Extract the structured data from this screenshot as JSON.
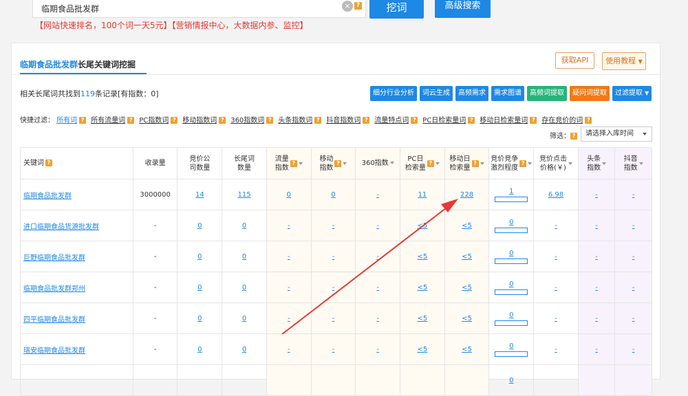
{
  "search": {
    "query": "临期食品批发群",
    "dig_button": "挖词",
    "advanced_button": "高级搜索"
  },
  "promo_text": "【网站快速排名，100个词一天5元】【营销情报中心，大数据内参、监控】",
  "panel": {
    "title_keyword": "临期食品批发群",
    "title_suffix": "长尾关键词挖掘",
    "api_button": "获取API",
    "tutorial_button": "使用教程"
  },
  "summary": {
    "prefix": "相关长尾词共找到",
    "count": "119",
    "suffix": "条记录[有指数：0]"
  },
  "tool_buttons": [
    {
      "label": "细分行业分析",
      "color": "blue"
    },
    {
      "label": "词云生成",
      "color": "blue"
    },
    {
      "label": "高频需求",
      "color": "blue"
    },
    {
      "label": "需求图谱",
      "color": "blue"
    },
    {
      "label": "高频词提取",
      "color": "green"
    },
    {
      "label": "疑问词提取",
      "color": "orange"
    },
    {
      "label": "过滤提取",
      "color": "blue"
    }
  ],
  "filters": {
    "label": "快捷过滤：",
    "items": [
      "所有词",
      "所有流量词",
      "PC指数词",
      "移动指数词",
      "360指数词",
      "头条指数词",
      "抖音指数词",
      "流量特点词",
      "PC日检索量词",
      "移动日检索量词",
      "存在竞价的词"
    ]
  },
  "screen": {
    "label": "筛选：",
    "select_value": "请选择入库时间"
  },
  "table": {
    "headers": [
      "关键词",
      "收录量",
      "竞价公司数量",
      "长尾词数量",
      "流量指数",
      "移动指数",
      "360指数",
      "PC日检索量",
      "移动日检索量",
      "竞价竞争激烈程度",
      "竞价点击价格(￥)",
      "头条指数",
      "抖音指数"
    ],
    "headers_display": [
      [
        "关键词"
      ],
      [
        "收录量"
      ],
      [
        "竞价公",
        "司数量"
      ],
      [
        "长尾词",
        "数量"
      ],
      [
        "流量",
        "指数"
      ],
      [
        "移动",
        "指数"
      ],
      [
        "360指数"
      ],
      [
        "PC日",
        "检索量"
      ],
      [
        "移动日",
        "检索量"
      ],
      [
        "竞价竞争",
        "激烈程度"
      ],
      [
        "竞价点击",
        "价格(￥)"
      ],
      [
        "头条",
        "指数"
      ],
      [
        "抖音",
        "指数"
      ]
    ],
    "rows": [
      {
        "kw": "临期食品批发群",
        "sl": "3000000",
        "jj": "14",
        "cw": "115",
        "ll": "0",
        "yd": "0",
        "s360": "-",
        "pc": "11",
        "mob": "228",
        "comp": "1",
        "price": "6.98",
        "tt": "-",
        "dy": "-"
      },
      {
        "kw": "进口临期食品货源批发群",
        "sl": "-",
        "jj": "0",
        "cw": "0",
        "ll": "-",
        "yd": "-",
        "s360": "-",
        "pc": "<5",
        "mob": "<5",
        "comp": "0",
        "price": "-",
        "tt": "-",
        "dy": "-"
      },
      {
        "kw": "巨野临期食品批发群",
        "sl": "-",
        "jj": "0",
        "cw": "0",
        "ll": "-",
        "yd": "-",
        "s360": "-",
        "pc": "<5",
        "mob": "<5",
        "comp": "0",
        "price": "-",
        "tt": "-",
        "dy": "-"
      },
      {
        "kw": "临期食品批发群郑州",
        "sl": "-",
        "jj": "0",
        "cw": "0",
        "ll": "-",
        "yd": "-",
        "s360": "-",
        "pc": "<5",
        "mob": "<5",
        "comp": "0",
        "price": "-",
        "tt": "-",
        "dy": "-"
      },
      {
        "kw": "四平临期食品批发群",
        "sl": "-",
        "jj": "0",
        "cw": "0",
        "ll": "-",
        "yd": "-",
        "s360": "-",
        "pc": "<5",
        "mob": "<5",
        "comp": "0",
        "price": "-",
        "tt": "-",
        "dy": "-"
      },
      {
        "kw": "瑞安临期食品批发群",
        "sl": "-",
        "jj": "0",
        "cw": "0",
        "ll": "-",
        "yd": "-",
        "s360": "-",
        "pc": "<5",
        "mob": "<5",
        "comp": "0",
        "price": "-",
        "tt": "-",
        "dy": "-"
      },
      {
        "kw": "",
        "sl": "",
        "jj": "",
        "cw": "",
        "ll": "",
        "yd": "",
        "s360": "",
        "pc": "",
        "mob": "",
        "comp": "0",
        "price": "",
        "tt": "",
        "dy": ""
      }
    ]
  },
  "colors": {
    "accent": "#1e88e5",
    "promo": "#e53935",
    "arrow": "#e53935"
  }
}
